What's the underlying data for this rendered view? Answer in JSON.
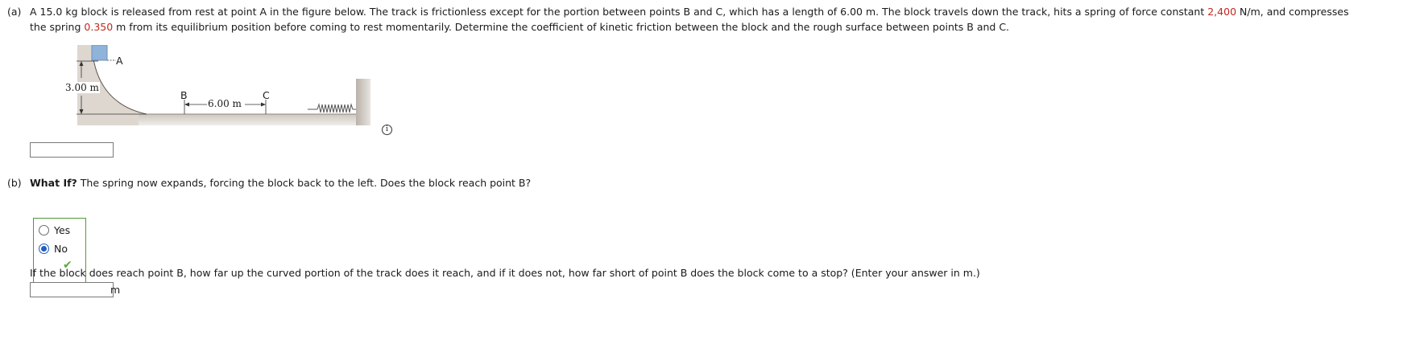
{
  "part_a": {
    "label": "(a)",
    "line1_pre": "A 15.0 kg block is released from rest at point A in the figure below. The track is frictionless except for the portion between points B and C, which has a length of 6.00 m. The block travels down the track, hits a spring of force constant ",
    "spring_k": "2,400",
    "line1_post": " N/m, and compresses",
    "line2_pre": "the spring ",
    "compression": "0.350",
    "line2_post": " m from its equilibrium position before coming to rest momentarily. Determine the coefficient of kinetic friction between the block and the rough surface between points B and C.",
    "answer_value": ""
  },
  "figure": {
    "label_a": "A",
    "label_b": "B",
    "label_c": "C",
    "height_label": "3.00 m",
    "length_label": "6.00 m",
    "info_glyph": "i"
  },
  "part_b": {
    "label": "(b)",
    "prompt_bold": "What If?",
    "prompt_rest": " The spring now expands, forcing the block back to the left. Does the block reach point B?",
    "options": [
      {
        "label": "Yes",
        "selected": false
      },
      {
        "label": "No",
        "selected": true
      }
    ],
    "check_glyph": "✔",
    "follow_up": "If the block does reach point B, how far up the curved portion of the track does it reach, and if it does not, how far short of point B does the block come to a stop? (Enter your answer in m.)",
    "answer_value": "",
    "unit": "m"
  },
  "colors": {
    "highlight_red": "#c0281e",
    "correct_green": "#4f9a3a",
    "radio_blue": "#1f5fbf",
    "block_blue": "#8fb3d9"
  }
}
